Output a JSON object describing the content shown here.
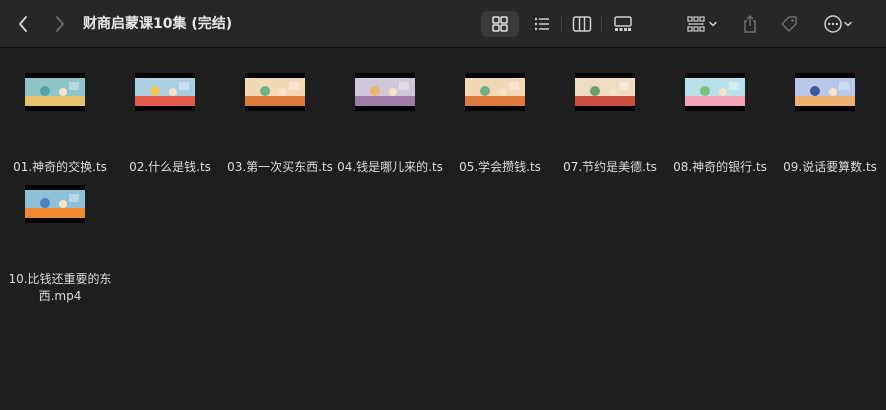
{
  "window": {
    "title": "财商启蒙课10集 (完结)"
  },
  "toolbar": {
    "back": "back",
    "forward": "forward",
    "views": [
      "icon-view",
      "list-view",
      "column-view",
      "gallery-view"
    ],
    "actions": [
      "group",
      "share",
      "tags",
      "more"
    ]
  },
  "files": [
    {
      "name": "01.神奇的交换.ts",
      "thumb_colors": [
        "#8fc4c8",
        "#e8c26a",
        "#5aa0a8"
      ]
    },
    {
      "name": "02.什么是钱.ts",
      "thumb_colors": [
        "#a9cfe0",
        "#e35b4b",
        "#f2c85a"
      ]
    },
    {
      "name": "03.第一次买东西.ts",
      "thumb_colors": [
        "#f3d8b5",
        "#e07a3a",
        "#6db08a"
      ]
    },
    {
      "name": "04.钱是哪儿来的.ts",
      "thumb_colors": [
        "#cfc8d8",
        "#a07aa8",
        "#e9b76a"
      ]
    },
    {
      "name": "05.学会攒钱.ts",
      "thumb_colors": [
        "#f3d8b5",
        "#e07a3a",
        "#6db08a"
      ]
    },
    {
      "name": "07.节约是美德.ts",
      "thumb_colors": [
        "#f0dcc2",
        "#c8503c",
        "#6aa06a"
      ]
    },
    {
      "name": "08.神奇的银行.ts",
      "thumb_colors": [
        "#b8e0ea",
        "#f2a3b8",
        "#7cc27a"
      ]
    },
    {
      "name": "09.说话要算数.ts",
      "thumb_colors": [
        "#b9c8e8",
        "#f0b070",
        "#3a5a9a"
      ]
    },
    {
      "name": "10.比钱还重要的东西.mp4",
      "thumb_colors": [
        "#8fc0d8",
        "#f08a30",
        "#4a84c0"
      ]
    }
  ]
}
